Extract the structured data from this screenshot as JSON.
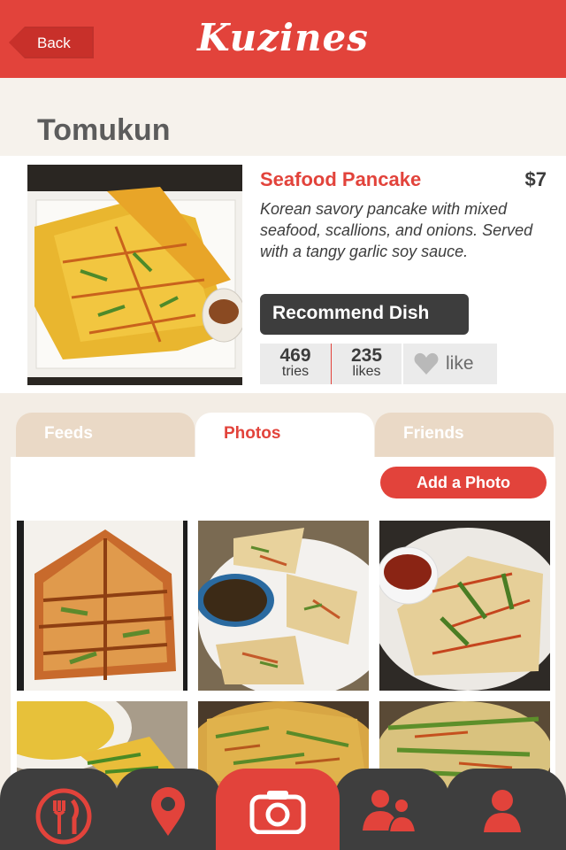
{
  "header": {
    "back_label": "Back",
    "app_title": "Kuzines"
  },
  "restaurant": {
    "name": "Tomukun"
  },
  "dish": {
    "name": "Seafood Pancake",
    "price": "$7",
    "description": "Korean savory pancake with mixed seafood, scallions, and onions. Served with a tangy garlic soy sauce.",
    "recommend_label": "Recommend Dish",
    "tries_count": "469",
    "tries_label": "tries",
    "likes_count": "235",
    "likes_label": "likes",
    "like_label": "like"
  },
  "tabs": [
    {
      "label": "Feeds",
      "active": false
    },
    {
      "label": "Photos",
      "active": true
    },
    {
      "label": "Friends",
      "active": false
    }
  ],
  "photos": {
    "add_label": "Add a Photo"
  },
  "bottom_nav": [
    {
      "icon": "fork-knife-icon",
      "active": false
    },
    {
      "icon": "map-pin-icon",
      "active": false
    },
    {
      "icon": "camera-icon",
      "active": true
    },
    {
      "icon": "friends-icon",
      "active": false
    },
    {
      "icon": "profile-icon",
      "active": false
    }
  ],
  "colors": {
    "brand_red": "#e2433b",
    "dark_gray": "#3e3e3e",
    "tab_inactive": "#ead9c6"
  }
}
